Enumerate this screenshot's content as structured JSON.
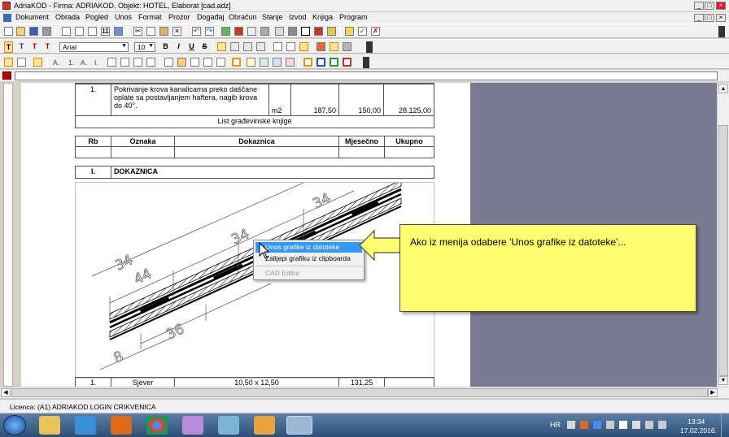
{
  "window": {
    "title": "AdriaKOD - Firma: ADRIAKOD,   Objekt: HOTEL, Elaborat [cad.adz]"
  },
  "menu": [
    "Dokument",
    "Obrada",
    "Pogled",
    "Unos",
    "Format",
    "Prozor",
    "Događaj",
    "Obračun",
    "Stanje",
    "Izvod",
    "Knjiga",
    "Program"
  ],
  "format_bar": {
    "font": "Arial",
    "size": "10",
    "bold": "B",
    "italic": "I",
    "underline": "U",
    "strike": "S",
    "t_labels": [
      "T",
      "T",
      "T",
      "T"
    ]
  },
  "list_bar": {
    "styles": [
      "A.",
      "1.",
      "A.",
      "I."
    ]
  },
  "document": {
    "item": {
      "rb": "1.",
      "description": "Pokrivanje krova kanalicama preko daščane oplate sa postavljanjem haftera, nagib krova do 40°.",
      "unit": "m2",
      "quantity": "187,50",
      "price": "150,00",
      "total": "28.125,00"
    },
    "book_title": "List građevinske knjige",
    "headers": [
      "Rb",
      "Oznaka",
      "Dokaznica",
      "Mjesečno",
      "Ukupno"
    ],
    "section": {
      "rb": "I.",
      "title": "DOKAZNICA"
    },
    "drawing_dims": [
      "34",
      "34",
      "34",
      "44",
      "36",
      "8"
    ],
    "bottom_row": {
      "rb": "1.",
      "oznaka": "Sjever",
      "dokaznica": "10,50 x 12,50",
      "mjesecno": "131,25"
    }
  },
  "context_menu": {
    "items": [
      "Unos grafike iz datoteke",
      "Zalijepi grafiku iz clipboarda",
      "CAD Editor"
    ],
    "active": 0,
    "disabled": [
      2
    ]
  },
  "callout": {
    "text": "Ako iz menija odabere 'Unos grafike iz datoteke'..."
  },
  "status": {
    "licence": "Licenca: (A1) ADRIAKOD LOGIN CRIKVENICA"
  },
  "taskbar": {
    "lang": "HR",
    "time": "13:34",
    "date": "17.02.2016."
  },
  "colors": {
    "callout_bg": "#ffff70",
    "gray_panel": "#7b7a93",
    "menu_highlight": "#3399ff",
    "red_marker": "#c00000"
  }
}
